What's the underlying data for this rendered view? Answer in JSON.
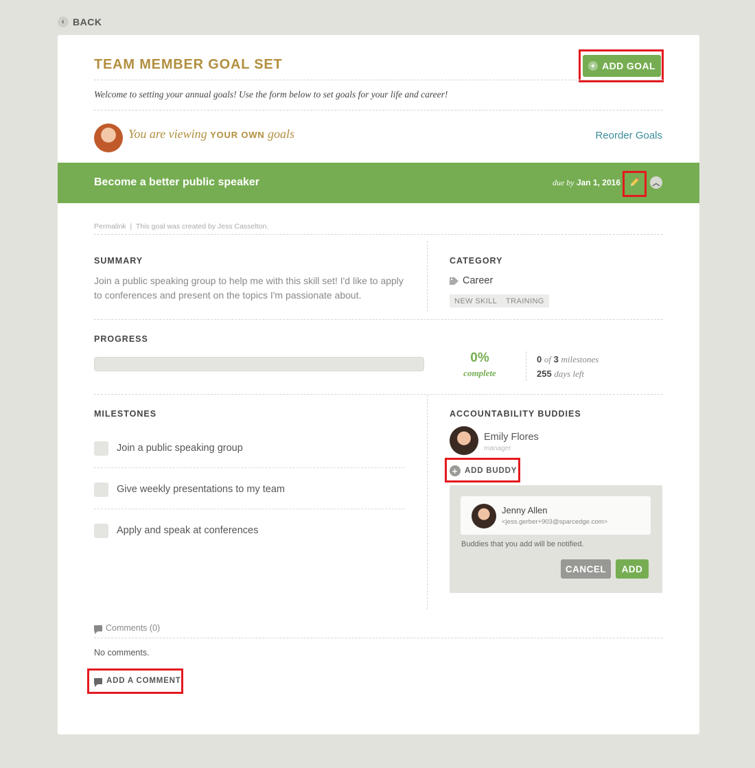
{
  "nav": {
    "back_label": "BACK"
  },
  "header": {
    "title": "TEAM MEMBER GOAL SET",
    "add_goal_label": "ADD GOAL",
    "welcome": "Welcome to setting your annual goals! Use the form below to set goals for your life and career!"
  },
  "viewer": {
    "prefix": "You are viewing ",
    "emphasis": "YOUR OWN",
    "suffix": " goals",
    "reorder_label": "Reorder Goals"
  },
  "goal": {
    "title": "Become a better public speaker",
    "due_prefix": "due by",
    "due_date": "Jan 1, 2016",
    "permalink_label": "Permalink",
    "separator": "|",
    "created_by": "This goal was created by Jess Casselton.",
    "summary_label": "SUMMARY",
    "summary_text": "Join a public speaking group to help me with this skill set! I'd like to apply to conferences and present on the topics I'm passionate about.",
    "category_label": "CATEGORY",
    "category_value": "Career",
    "tags": [
      "NEW SKILL",
      "TRAINING"
    ],
    "progress_label": "PROGRESS",
    "progress_fraction": 0,
    "percent": "0%",
    "percent_sub": "complete",
    "milestones_done": "0",
    "milestones_of": "of",
    "milestones_total": "3",
    "milestones_word": "milestones",
    "days_left": "255",
    "days_left_word": "days left",
    "milestones_label": "MILESTONES",
    "milestones": [
      "Join a public speaking group",
      "Give weekly presentations to my team",
      "Apply and speak at conferences"
    ]
  },
  "buddies": {
    "label": "ACCOUNTABILITY BUDDIES",
    "existing_name": "Emily Flores",
    "existing_role": "manager",
    "add_buddy_label": "ADD BUDDY",
    "candidate_name": "Jenny Allen",
    "candidate_email": "<jess.gerber+903@sparcedge.com>",
    "notify_text": "Buddies that you add will be notified.",
    "cancel_label": "CANCEL",
    "add_label": "ADD"
  },
  "comments": {
    "header": "Comments (0)",
    "empty_text": "No comments.",
    "add_label": "ADD A COMMENT"
  },
  "colors": {
    "accent_green": "#76ad52",
    "title_gold": "#b28f3e",
    "link_teal": "#3b8d9a",
    "highlight_red": "#e3191e"
  }
}
